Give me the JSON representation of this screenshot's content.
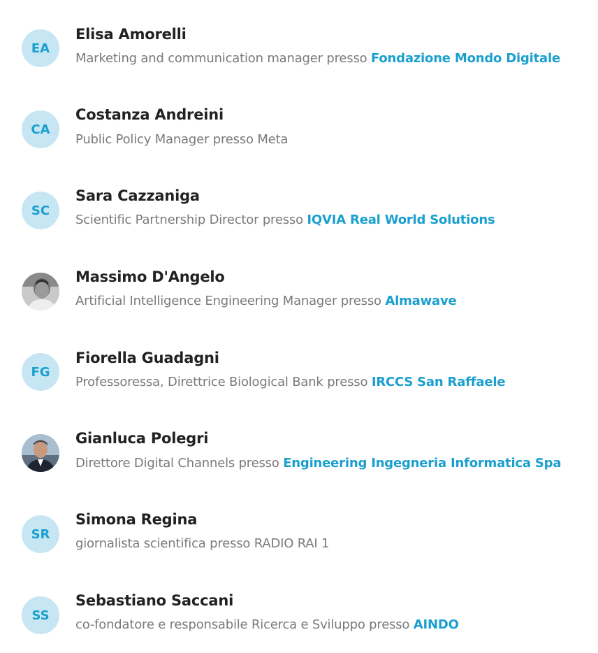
{
  "people": [
    {
      "initials": "EA",
      "name": "Elisa Amorelli",
      "role": "Marketing and communication manager",
      "connector": "presso",
      "org": "Fondazione Mondo Digitale",
      "org_link": true,
      "avatar_type": "initials"
    },
    {
      "initials": "CA",
      "name": "Costanza Andreini",
      "role": "Public Policy Manager",
      "connector": "presso",
      "org": "Meta",
      "org_link": false,
      "avatar_type": "initials"
    },
    {
      "initials": "SC",
      "name": "Sara Cazzaniga",
      "role": "Scientific Partnership Director",
      "connector": "presso",
      "org": "IQVIA Real World Solutions",
      "org_link": true,
      "avatar_type": "initials"
    },
    {
      "initials": "",
      "name": "Massimo D'Angelo",
      "role": "Artificial Intelligence Engineering Manager",
      "connector": "presso",
      "org": "Almawave",
      "org_link": true,
      "avatar_type": "photo-bw"
    },
    {
      "initials": "FG",
      "name": "Fiorella Guadagni",
      "role": "Professoressa, Direttrice Biological Bank",
      "connector": "presso",
      "org": "IRCCS San Raffaele",
      "org_link": true,
      "avatar_type": "initials"
    },
    {
      "initials": "",
      "name": "Gianluca Polegri",
      "role": "Direttore Digital Channels",
      "connector": "presso",
      "org": "Engineering Ingegneria Informatica Spa",
      "org_link": true,
      "avatar_type": "photo-color"
    },
    {
      "initials": "SR",
      "name": "Simona Regina",
      "role": "giornalista scientifica",
      "connector": "presso",
      "org": "RADIO RAI 1",
      "org_link": false,
      "avatar_type": "initials"
    },
    {
      "initials": "SS",
      "name": "Sebastiano Saccani",
      "role": "co-fondatore e responsabile Ricerca e Sviluppo",
      "connector": "presso",
      "org": "AINDO",
      "org_link": true,
      "avatar_type": "initials"
    }
  ],
  "colors": {
    "accent": "#1a9fce",
    "avatar_bg": "#c7e6f3",
    "name": "#222222",
    "muted": "#7a7a7a"
  }
}
